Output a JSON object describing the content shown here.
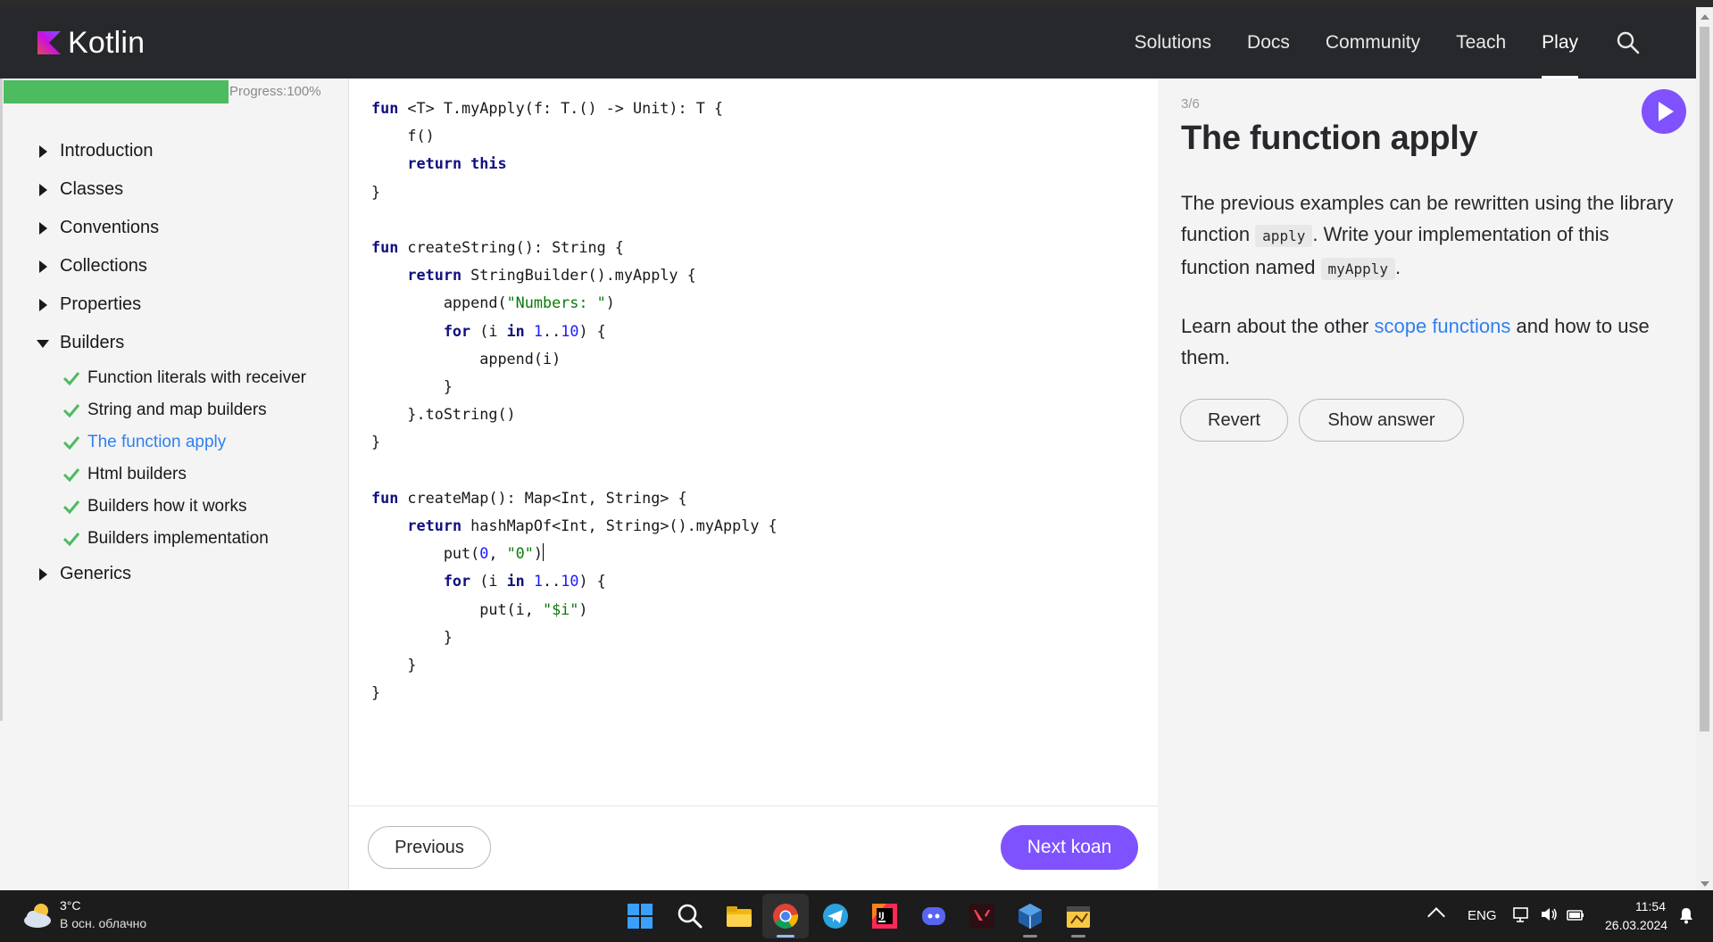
{
  "header": {
    "brand": "Kotlin",
    "nav": [
      "Solutions",
      "Docs",
      "Community",
      "Teach",
      "Play"
    ],
    "active_nav": "Play"
  },
  "sidebar": {
    "progress_label": "Progress:100%",
    "progress_fraction": 1.0,
    "sections": [
      {
        "label": "Introduction",
        "expanded": false
      },
      {
        "label": "Classes",
        "expanded": false
      },
      {
        "label": "Conventions",
        "expanded": false
      },
      {
        "label": "Collections",
        "expanded": false
      },
      {
        "label": "Properties",
        "expanded": false
      },
      {
        "label": "Builders",
        "expanded": true
      },
      {
        "label": "Generics",
        "expanded": false
      }
    ],
    "builders_tasks": [
      "Function literals with receiver",
      "String and map builders",
      "The function apply",
      "Html builders",
      "Builders how it works",
      "Builders implementation"
    ],
    "current_task": "The function apply"
  },
  "code": {
    "lines": [
      "fun <T> T.myApply(f: T.() -> Unit): T {",
      "    f()",
      "    return this",
      "}",
      "",
      "fun createString(): String {",
      "    return StringBuilder().myApply {",
      "        append(\"Numbers: \")",
      "        for (i in 1..10) {",
      "            append(i)",
      "        }",
      "    }.toString()",
      "}",
      "",
      "fun createMap(): Map<Int, String> {",
      "    return hashMapOf<Int, String>().myApply {",
      "        put(0, \"0\")",
      "        for (i in 1..10) {",
      "            put(i, \"$i\")",
      "        }",
      "    }",
      "}"
    ]
  },
  "footer": {
    "previous": "Previous",
    "next": "Next koan"
  },
  "task": {
    "counter": "3/6",
    "title": "The function apply",
    "p1_a": "The previous examples can be rewritten using the library function ",
    "p1_code1": "apply",
    "p1_b": ". Write your implementation of this function named ",
    "p1_code2": "myApply",
    "p1_c": ".",
    "p2_a": "Learn about the other ",
    "p2_link": "scope functions",
    "p2_b": " and how to use them.",
    "revert": "Revert",
    "show_answer": "Show answer"
  },
  "taskbar": {
    "temperature": "3°C",
    "weather": "В осн. облачно",
    "lang": "ENG",
    "time": "11:54",
    "date": "26.03.2024",
    "apps": [
      "start-icon",
      "search-icon",
      "file-explorer-icon",
      "chrome-icon",
      "telegram-icon",
      "intellij-icon",
      "discord-icon",
      "valorant-icon",
      "virtualbox-icon",
      "app-icon"
    ]
  },
  "colors": {
    "accent": "#7f52ff",
    "progress": "#4dbb5f",
    "link": "#307ff0",
    "header_bg": "#27282c"
  }
}
